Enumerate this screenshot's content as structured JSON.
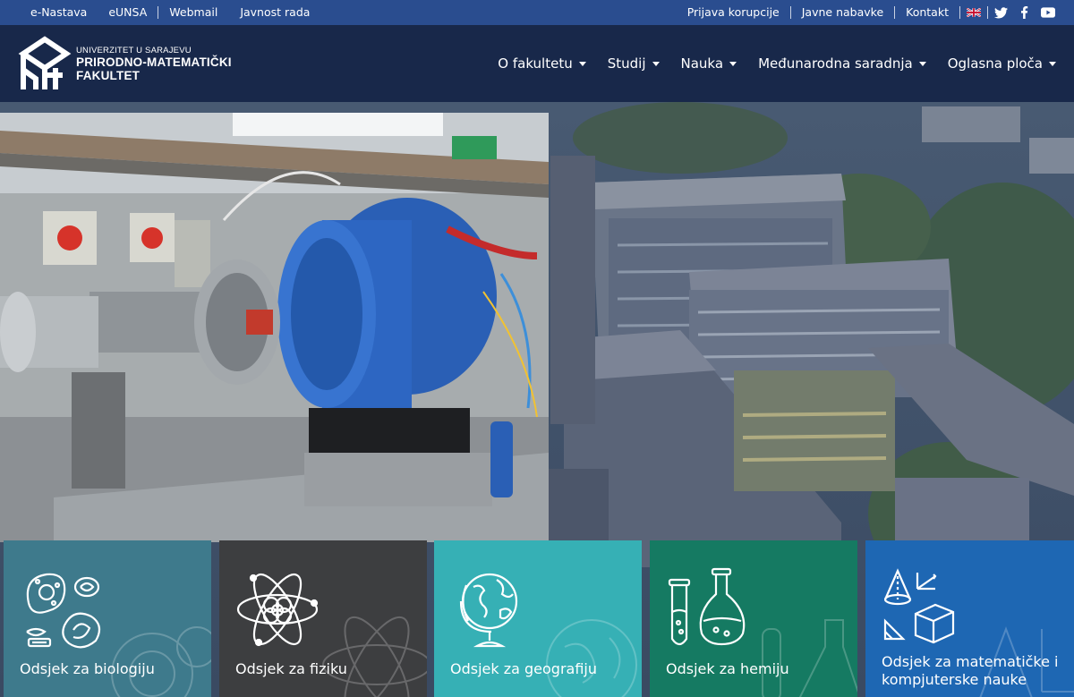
{
  "topbar": {
    "left_links": [
      "e-Nastava",
      "eUNSA",
      "Webmail",
      "Javnost rada"
    ],
    "right_links": [
      "Prijava korupcije",
      "Javne nabavke",
      "Kontakt"
    ],
    "icons": [
      "uk-flag-icon",
      "twitter-icon",
      "facebook-icon",
      "youtube-icon"
    ]
  },
  "logo": {
    "line1": "UNIVERZITET U SARAJEVU",
    "line2": "PRIRODNO-MATEMATIČKI",
    "line3": "FAKULTET"
  },
  "nav": {
    "items": [
      {
        "label": "O fakultetu"
      },
      {
        "label": "Studij"
      },
      {
        "label": "Nauka"
      },
      {
        "label": "Međunarodna saradnja"
      },
      {
        "label": "Oglasna ploča"
      }
    ]
  },
  "hero": {
    "photo_subject": "laboratory-equipment-photo",
    "background_subject": "campus-aerial-photo"
  },
  "departments": [
    {
      "label": "Odsjek za biologiju",
      "color": "#3e7a8c",
      "icon": "biology-cells-icon"
    },
    {
      "label": "Odsjek za fiziku",
      "color": "#3d3e40",
      "icon": "atom-icon"
    },
    {
      "label": "Odsjek za geografiju",
      "color": "#36b0b5",
      "icon": "globe-icon"
    },
    {
      "label": "Odsjek za hemiju",
      "color": "#157a62",
      "icon": "flask-icon"
    },
    {
      "label": "Odsjek za matematičke i kompjuterske nauke",
      "color": "#1e67b3",
      "icon": "geometry-icon"
    }
  ],
  "colors": {
    "topbar": "#2a4d8f",
    "header": "#18284a"
  }
}
